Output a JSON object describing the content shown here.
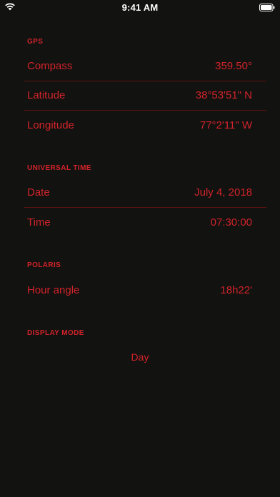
{
  "status_bar": {
    "time": "9:41 AM"
  },
  "gps": {
    "header": "GPS",
    "compass": {
      "label": "Compass",
      "value": "359.50°"
    },
    "latitude": {
      "label": "Latitude",
      "value": "38°53'51\" N"
    },
    "longitude": {
      "label": "Longitude",
      "value": "77°2'11\" W"
    }
  },
  "universal_time": {
    "header": "UNIVERSAL TIME",
    "date": {
      "label": "Date",
      "value": "July 4, 2018"
    },
    "time": {
      "label": "Time",
      "value": "07:30:00"
    }
  },
  "polaris": {
    "header": "POLARIS",
    "hour_angle": {
      "label": "Hour angle",
      "value": "18h22'"
    }
  },
  "display_mode": {
    "header": "DISPLAY MODE",
    "value": "Day"
  },
  "colors": {
    "background": "#121210",
    "accent": "#d1232a",
    "separator": "#5a1212",
    "status_text": "#ffffff"
  }
}
